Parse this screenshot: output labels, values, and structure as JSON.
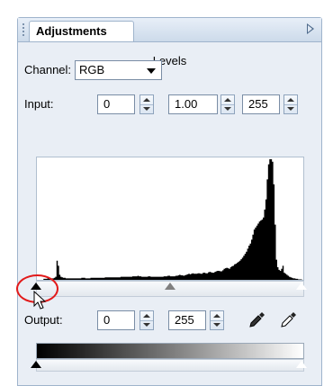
{
  "panel": {
    "tab_label": "Adjustments",
    "title": "Levels"
  },
  "channel": {
    "label": "Channel:",
    "value": "RGB"
  },
  "input": {
    "label": "Input:",
    "black": "0",
    "gamma": "1.00",
    "white": "255"
  },
  "output": {
    "label": "Output:",
    "black": "0",
    "white": "255"
  },
  "histogram": {
    "levels": [
      0,
      0,
      0,
      0,
      0,
      2,
      2,
      2,
      3,
      2,
      3,
      3,
      3,
      4,
      6,
      38,
      28,
      10,
      6,
      5,
      4,
      4,
      3,
      3,
      3,
      3,
      3,
      3,
      3,
      3,
      3,
      3,
      3,
      3,
      4,
      4,
      4,
      3,
      3,
      3,
      3,
      4,
      4,
      4,
      4,
      4,
      4,
      4,
      4,
      4,
      4,
      4,
      5,
      5,
      5,
      5,
      5,
      5,
      5,
      5,
      5,
      5,
      5,
      5,
      6,
      6,
      6,
      6,
      6,
      6,
      6,
      6,
      6,
      7,
      7,
      7,
      7,
      8,
      7,
      7,
      6,
      6,
      6,
      6,
      6,
      7,
      7,
      6,
      6,
      6,
      6,
      6,
      6,
      6,
      6,
      6,
      6,
      7,
      7,
      7,
      8,
      8,
      7,
      7,
      7,
      7,
      8,
      8,
      9,
      10,
      9,
      9,
      8,
      9,
      10,
      11,
      12,
      11,
      12,
      13,
      12,
      12,
      12,
      13,
      13,
      12,
      12,
      14,
      14,
      13,
      13,
      15,
      16,
      15,
      14,
      14,
      16,
      17,
      18,
      18,
      17,
      17,
      19,
      22,
      23,
      24,
      23,
      22,
      25,
      27,
      28,
      31,
      32,
      34,
      36,
      38,
      41,
      44,
      48,
      52,
      56,
      62,
      68,
      72,
      80,
      90,
      100,
      104,
      108,
      112,
      116,
      118,
      120,
      124,
      140,
      160,
      200,
      230,
      240,
      240,
      235,
      190,
      110,
      40,
      25,
      20,
      18,
      22,
      28,
      14,
      12,
      10,
      8,
      6,
      5,
      4,
      3,
      3,
      2,
      2,
      1,
      1,
      1,
      0
    ],
    "max": 240,
    "black_point": 0,
    "gamma_point": 0.5,
    "white_point": 1
  }
}
